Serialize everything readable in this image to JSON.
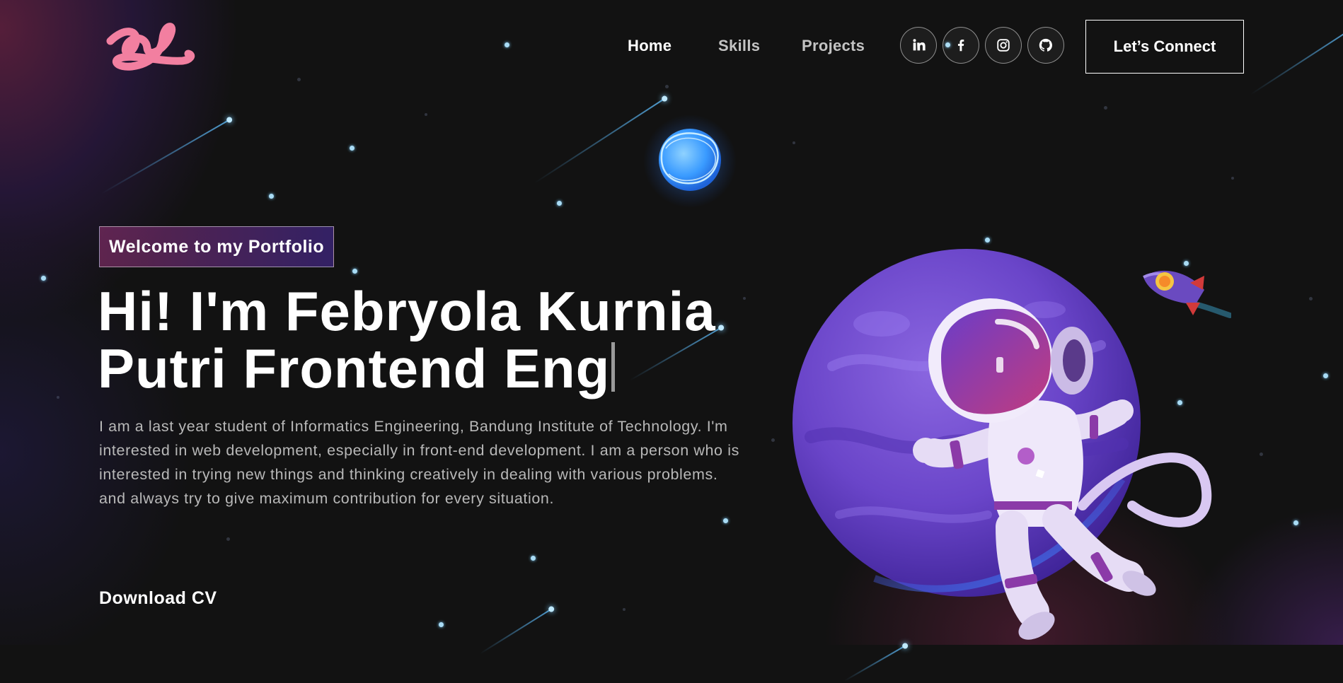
{
  "nav": {
    "logo_icon": "pink-script-logo",
    "links": [
      {
        "label": "Home",
        "active": true
      },
      {
        "label": "Skills",
        "active": false
      },
      {
        "label": "Projects",
        "active": false
      }
    ],
    "social_icons": [
      "linkedin-icon",
      "facebook-icon",
      "instagram-icon",
      "github-icon"
    ],
    "connect_label": "Let’s Connect"
  },
  "hero": {
    "tagline": "Welcome to my Portfolio",
    "headline_line1": "Hi! I'm Febryola Kurnia",
    "headline_line2": "Putri Frontend Eng",
    "bio": "I am a last year student of Informatics Engineering, Bandung Institute of Technology. I'm interested in web development, especially in front-end development. I am a person who is interested in trying new things and thinking creatively in dealing with various problems. and always try to give maximum contribution for every situation.",
    "download_label": "Download CV"
  },
  "illustration": {
    "items": [
      "astronaut",
      "purple-planet",
      "blue-glowing-planet",
      "rocket",
      "meteors",
      "stars"
    ]
  },
  "colors": {
    "background": "#121212",
    "logo_pink": "#f27fa0",
    "tagline_gradient_start": "#aa367c",
    "tagline_gradient_end": "#4a2fbd",
    "planet_purple": "#6a45c9",
    "blue_planet": "#4aa8ff"
  }
}
